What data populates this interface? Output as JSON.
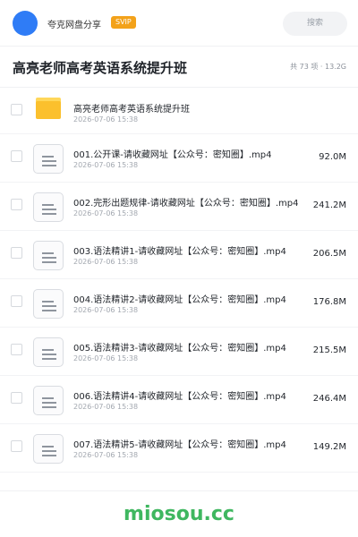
{
  "header": {
    "share_name": "夸克网盘分享",
    "badge": "SVIP",
    "search_placeholder": "搜索"
  },
  "folder": {
    "title": "高亮老师高考英语系统提升班",
    "meta": "共 73 项 · 13.2G"
  },
  "items": [
    {
      "type": "folder",
      "name": "高亮老师高考英语系统提升班",
      "date": "2026-07-06 15:38",
      "size": ""
    },
    {
      "type": "file",
      "name": "001.公开课-请收藏网址【公众号：密知圈】.mp4",
      "date": "2026-07-06 15:38",
      "size": "92.0M"
    },
    {
      "type": "file",
      "name": "002.完形出题规律-请收藏网址【公众号：密知圈】.mp4",
      "date": "2026-07-06 15:38",
      "size": "241.2M"
    },
    {
      "type": "file",
      "name": "003.语法精讲1-请收藏网址【公众号：密知圈】.mp4",
      "date": "2026-07-06 15:38",
      "size": "206.5M"
    },
    {
      "type": "file",
      "name": "004.语法精讲2-请收藏网址【公众号：密知圈】.mp4",
      "date": "2026-07-06 15:38",
      "size": "176.8M"
    },
    {
      "type": "file",
      "name": "005.语法精讲3-请收藏网址【公众号：密知圈】.mp4",
      "date": "2026-07-06 15:38",
      "size": "215.5M"
    },
    {
      "type": "file",
      "name": "006.语法精讲4-请收藏网址【公众号：密知圈】.mp4",
      "date": "2026-07-06 15:38",
      "size": "246.4M"
    },
    {
      "type": "file",
      "name": "007.语法精讲5-请收藏网址【公众号：密知圈】.mp4",
      "date": "2026-07-06 15:38",
      "size": "149.2M"
    }
  ],
  "footer": {
    "brand": "miosou.cc"
  },
  "colors": {
    "accent": "#2f7cf6",
    "svip": "#f3a21a",
    "folder": "#fbc02d",
    "brand": "#3fb760"
  },
  "icons": {
    "folder": "folder-icon",
    "file": "document-icon"
  }
}
